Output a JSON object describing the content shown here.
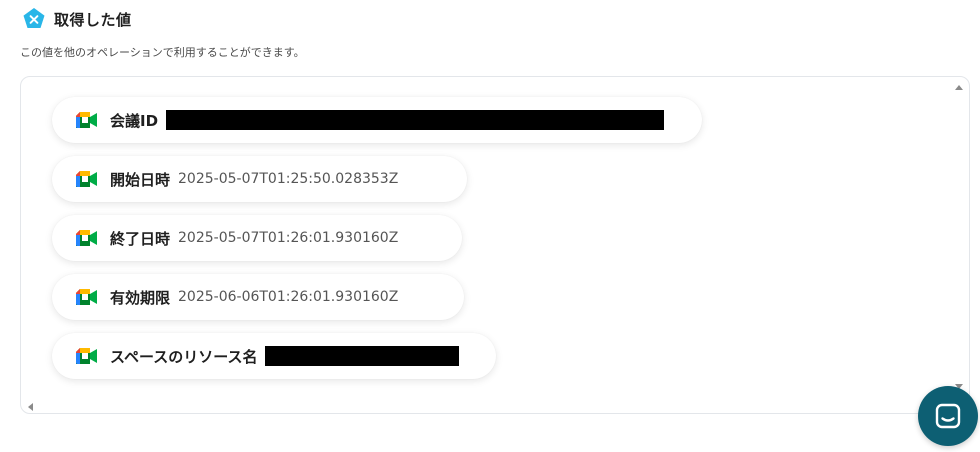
{
  "header": {
    "title": "取得した値",
    "badge_icon": "x-badge-icon",
    "description": "この値を他のオペレーションで利用することができます。"
  },
  "items": [
    {
      "label": "会議ID",
      "value": "",
      "redacted": true
    },
    {
      "label": "開始日時",
      "value": "2025-05-07T01:25:50.028353Z",
      "redacted": false
    },
    {
      "label": "終了日時",
      "value": "2025-05-07T01:26:01.930160Z",
      "redacted": false
    },
    {
      "label": "有効期限",
      "value": "2025-06-06T01:26:01.930160Z",
      "redacted": false
    },
    {
      "label": "スペースのリソース名",
      "value": "",
      "redacted": true
    }
  ],
  "icons": {
    "item_icon": "google-meet-icon",
    "chat": "chat-icon"
  },
  "colors": {
    "badge": "#29b6e8",
    "chat_button": "#0d5f73",
    "redaction": "#000000"
  }
}
